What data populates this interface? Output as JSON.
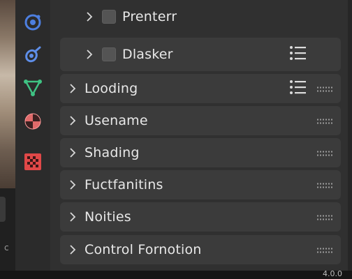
{
  "sub_items": [
    {
      "label": "Prenterr",
      "has_list_icon": false
    },
    {
      "label": "Dlasker",
      "has_list_icon": true
    }
  ],
  "panels": [
    {
      "label": "Looding",
      "has_list_icon": true
    },
    {
      "label": "Usename",
      "has_list_icon": false
    },
    {
      "label": "Shading",
      "has_list_icon": false
    },
    {
      "label": "Fuctfanitins",
      "has_list_icon": false
    },
    {
      "label": "Noities",
      "has_list_icon": false
    },
    {
      "label": "Control Fornotion",
      "has_list_icon": false
    }
  ],
  "tabs": [
    {
      "icon": "physics-icon",
      "color": "#4d7fe0"
    },
    {
      "icon": "constraints-icon",
      "color": "#5e8ee8"
    },
    {
      "icon": "object-data-icon",
      "color": "#3fc283"
    },
    {
      "icon": "material-icon",
      "color": "#e06a6a"
    },
    {
      "icon": "texture-icon",
      "color": "#e04848"
    }
  ],
  "left_edge_text": "c",
  "status_text": "4.0.0"
}
